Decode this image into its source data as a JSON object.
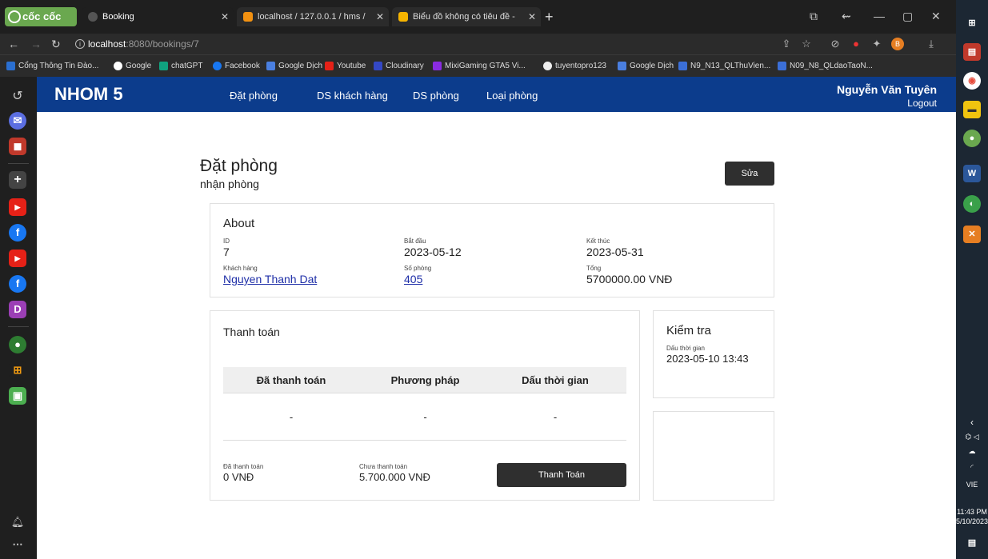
{
  "browser": {
    "brand": "cốc cốc",
    "tabs": [
      {
        "title": "Booking",
        "active": true
      },
      {
        "title": "localhost / 127.0.0.1 / hms / ",
        "active": false
      },
      {
        "title": "Biểu đồ không có tiêu đề - ",
        "active": false
      }
    ],
    "url_host": "localhost",
    "url_path": ":8080/bookings/7",
    "bookmarks": [
      "Cổng Thông Tin Đào...",
      "Google",
      "chatGPT",
      "Facebook",
      "Google Dịch",
      "Youtube",
      "Cloudinary",
      "MixiGaming GTA5 Vi...",
      "tuyentopro123",
      "Google Dịch",
      "N9_N13_QLThuVien...",
      "N09_N8_QLdaoTaoN..."
    ]
  },
  "app": {
    "brand": "NHOM 5",
    "nav": [
      "Đặt phòng",
      "DS khách hàng",
      "DS phòng",
      "Loại phòng"
    ],
    "user": "Nguyễn Văn Tuyên",
    "logout": "Logout"
  },
  "page": {
    "title": "Đặt phòng",
    "subtitle": "nhận phòng",
    "edit_label": "Sửa"
  },
  "about": {
    "title": "About",
    "id_label": "ID",
    "id_value": "7",
    "start_label": "Bắt đầu",
    "start_value": "2023-05-12",
    "end_label": "Kết thúc",
    "end_value": "2023-05-31",
    "customer_label": "Khách hàng",
    "customer_value": "Nguyen Thanh Dat",
    "room_label": "Số phòng",
    "room_value": "405",
    "total_label": "Tổng",
    "total_value": "5700000.00 VNĐ"
  },
  "payment": {
    "title": "Thanh toán",
    "headers": [
      "Đã thanh toán",
      "Phương pháp",
      "Dấu thời gian"
    ],
    "row": [
      "-",
      "-",
      "-"
    ],
    "paid_label": "Đã thanh toán",
    "paid_value": "0 VNĐ",
    "unpaid_label": "Chưa thanh toán",
    "unpaid_value": "5.700.000 VNĐ",
    "pay_button": "Thanh Toán"
  },
  "check": {
    "title": "Kiểm tra",
    "ts_label": "Dấu thời gian",
    "ts_value": "2023-05-10 13:43"
  },
  "taskbar": {
    "lang": "VIE",
    "time": "11:43 PM",
    "date": "5/10/2023"
  },
  "colors": {
    "navbar": "#0c3c8c",
    "button": "#2f2f2f",
    "link": "#1f2fa8"
  }
}
